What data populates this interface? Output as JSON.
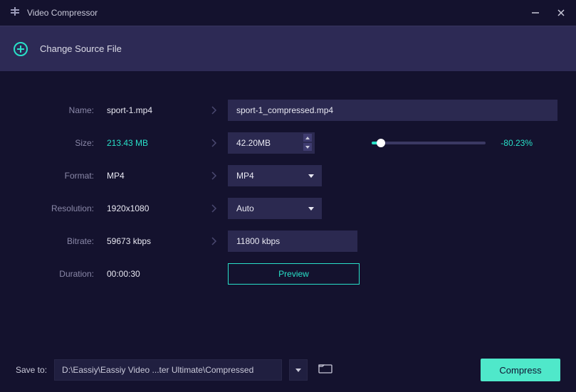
{
  "app": {
    "title": "Video Compressor"
  },
  "source": {
    "change_label": "Change Source File"
  },
  "fields": {
    "name": {
      "label": "Name:",
      "value": "sport-1.mp4",
      "output": "sport-1_compressed.mp4"
    },
    "size": {
      "label": "Size:",
      "value": "213.43 MB",
      "target": "42.20MB",
      "pct": "-80.23%"
    },
    "format": {
      "label": "Format:",
      "value": "MP4",
      "selected": "MP4"
    },
    "resolution": {
      "label": "Resolution:",
      "value": "1920x1080",
      "selected": "Auto"
    },
    "bitrate": {
      "label": "Bitrate:",
      "value": "59673 kbps",
      "target": "11800 kbps"
    },
    "duration": {
      "label": "Duration:",
      "value": "00:00:30"
    }
  },
  "buttons": {
    "preview": "Preview",
    "compress": "Compress"
  },
  "footer": {
    "save_label": "Save to:",
    "path": "D:\\Eassiy\\Eassiy Video ...ter Ultimate\\Compressed"
  },
  "colors": {
    "accent": "#29e0c8",
    "bg": "#14122e",
    "panel": "#2b2950"
  }
}
